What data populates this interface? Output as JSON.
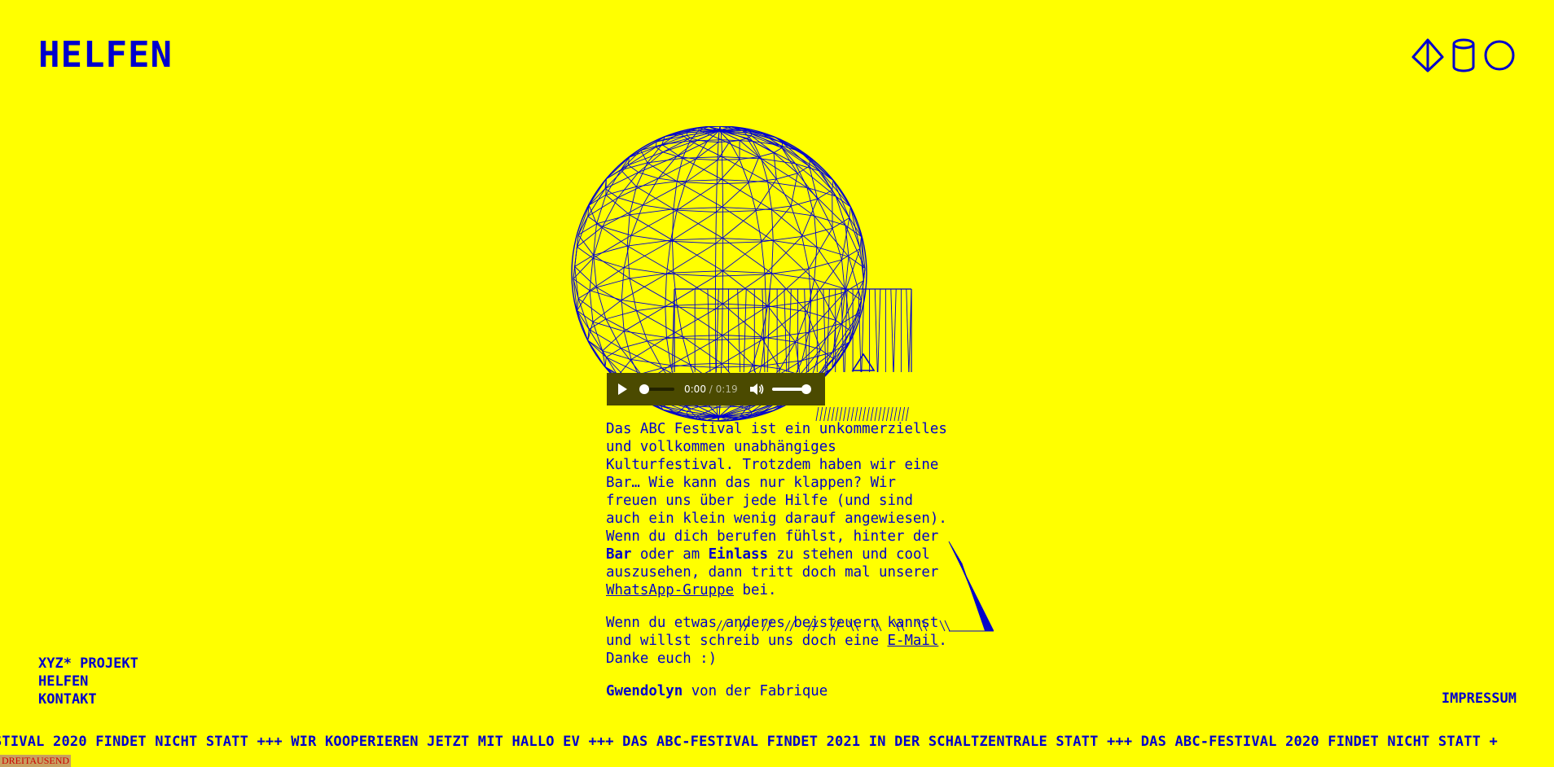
{
  "header": {
    "title": "HELFEN",
    "icons": [
      "pyramid-icon",
      "cylinder-icon",
      "circle-icon"
    ]
  },
  "audio": {
    "current_time": "0:00",
    "separator": "/",
    "duration": "0:19",
    "progress": 0,
    "volume": 1
  },
  "content": {
    "p1_a": "Das ABC Festival ist ein unkommerzielles und vollkommen unabhängiges Kulturfestival. Trotzdem haben wir eine Bar… Wie kann das nur klappen? Wir freuen uns über jede Hilfe (und sind auch ein klein wenig darauf angewiesen). Wenn du dich berufen fühlst, hinter der ",
    "p1_bold_bar": "Bar",
    "p1_b": " oder am ",
    "p1_bold_einlass": "Einlass",
    "p1_c": " zu stehen und cool auszusehen, dann tritt doch mal unserer ",
    "p1_link": "WhatsApp-Gruppe",
    "p1_d": " bei.",
    "p2_a": "Wenn du etwas anderes beisteuern kannst und willst schreib uns doch eine ",
    "p2_link": "E-Mail",
    "p2_b": ". Danke euch :)",
    "sig_bold": "Gwendolyn",
    "sig_rest": " von der Fabrique"
  },
  "footer_nav": {
    "items": [
      "XYZ* PROJEKT",
      "HELFEN",
      "KONTAKT"
    ]
  },
  "impressum": "IMPRESSUM",
  "ticker": "STIVAL 2020 FINDET NICHT STATT +++ WIR KOOPERIEREN JETZT MIT HALLO EV +++ DAS ABC-FESTIVAL FINDET 2021 IN DER SCHALTZENTRALE STATT +++ DAS ABC-FESTIVAL 2020 FINDET NICHT STATT +",
  "counter": "DREITAUSEND",
  "colors": {
    "background": "#ffff00",
    "accent": "#0000cc",
    "player": "#4b4a00"
  }
}
